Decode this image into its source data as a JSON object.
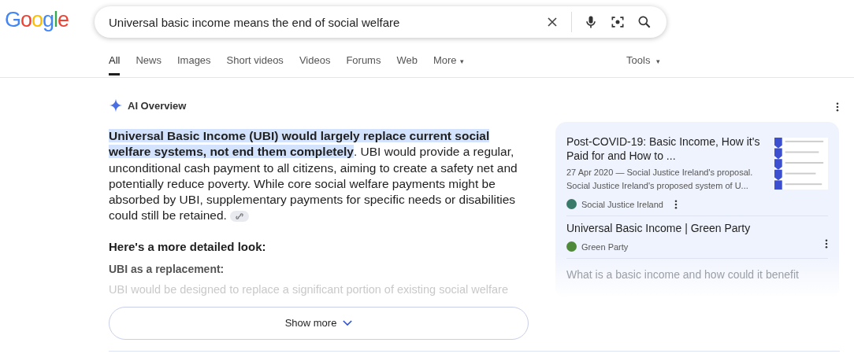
{
  "logo": {
    "letters": [
      {
        "text": "G",
        "color": "#4285f4"
      },
      {
        "text": "o",
        "color": "#ea4335"
      },
      {
        "text": "o",
        "color": "#fbbc05"
      },
      {
        "text": "g",
        "color": "#4285f4"
      },
      {
        "text": "l",
        "color": "#34a853"
      },
      {
        "text": "e",
        "color": "#ea4335"
      }
    ]
  },
  "search": {
    "value": "Universal basic income means the end of social welfare"
  },
  "tabs": [
    {
      "label": "All",
      "selected": true
    },
    {
      "label": "News",
      "selected": false
    },
    {
      "label": "Images",
      "selected": false
    },
    {
      "label": "Short videos",
      "selected": false
    },
    {
      "label": "Videos",
      "selected": false
    },
    {
      "label": "Forums",
      "selected": false
    },
    {
      "label": "Web",
      "selected": false
    },
    {
      "label": "More",
      "selected": false,
      "caret": "▾"
    }
  ],
  "tools": {
    "label": "Tools",
    "caret": "▾"
  },
  "overview": {
    "title": "AI Overview",
    "highlighted": "Universal Basic Income (UBI) would largely replace current social welfare systems, not end them completely",
    "rest": ". UBI would provide a regular, unconditional cash payment to all citizens, aiming to create a safety net and potentially reduce poverty. While core social welfare payments might be absorbed by UBI, supplementary payments for specific needs or disabilities could still be retained.",
    "heading": "Here's a more detailed look:",
    "subheading": "UBI as a replacement:",
    "faded_text": "UBI would be designed to replace a significant portion of existing social welfare",
    "show_more": "Show more"
  },
  "sources": [
    {
      "title": "Post-COVID-19: Basic Income, How it's Paid for and How to ...",
      "snippet": "27 Apr 2020 — Social Justice Ireland's proposal. Social Justice Ireland's proposed system of U...",
      "site": "Social Justice Ireland",
      "color": "#3a7a6a",
      "thumbnail": true,
      "faded": false
    },
    {
      "title": "Universal Basic Income | Green Party",
      "site": "Green Party",
      "color": "#4f8a3a",
      "thumbnail": false,
      "faded": false
    },
    {
      "title": "What is a basic income and how could it benefit",
      "faded": true
    }
  ]
}
